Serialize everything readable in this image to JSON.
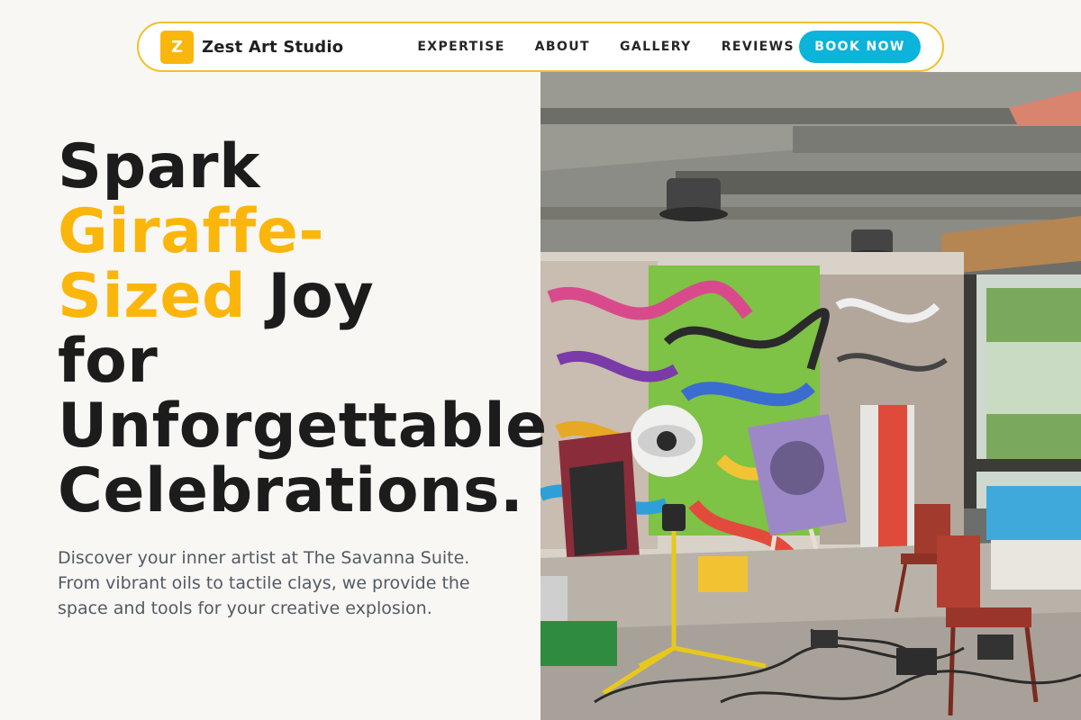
{
  "brand": {
    "mark": "Z",
    "name": "Zest Art Studio"
  },
  "nav": {
    "links": [
      "EXPERTISE",
      "ABOUT",
      "GALLERY",
      "REVIEWS"
    ],
    "cta": "BOOK NOW"
  },
  "hero": {
    "title_line1": "Spark",
    "title_accent1": "Giraffe-",
    "title_accent2": "Sized",
    "title_after_accent": " Joy",
    "title_line4": "for",
    "title_line5": "Unforgettable",
    "title_line6": "Celebrations.",
    "description": "Discover your inner artist at The Savanna Suite. From vibrant oils to tactile clays, we provide the space and tools for your creative explosion."
  },
  "colors": {
    "accent": "#fbb60b",
    "cta": "#0cb3da",
    "nav_border": "#f2c02a",
    "text": "#1c1c1c",
    "muted": "#525a64",
    "background": "#f9f7f4"
  },
  "icons": {
    "brand_mark": "z-logo-icon"
  }
}
